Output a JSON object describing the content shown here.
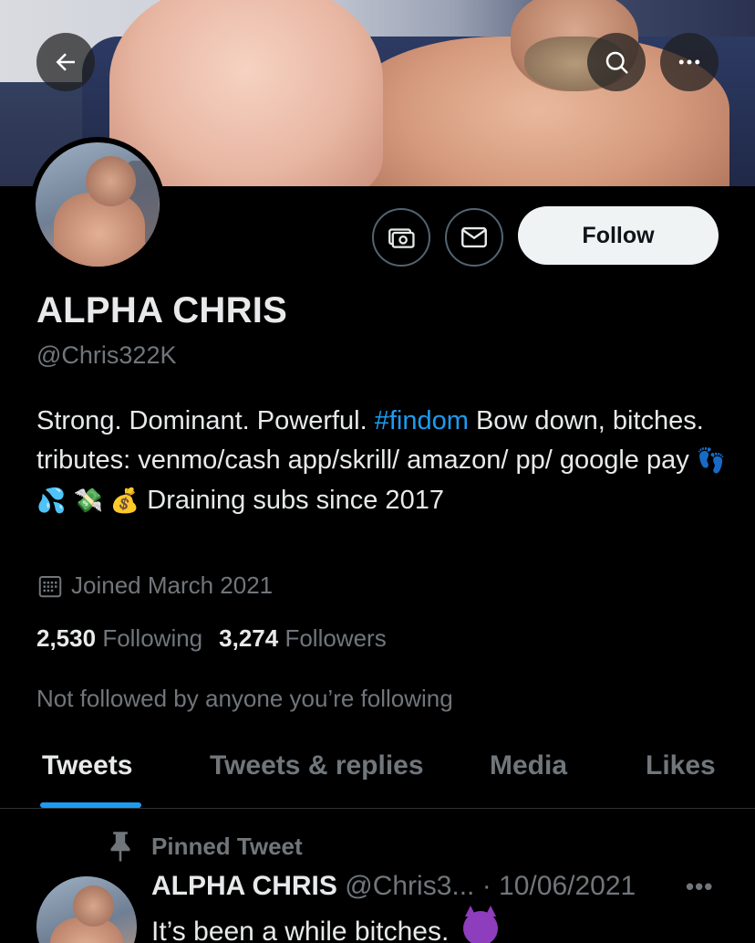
{
  "profile": {
    "name": "ALPHA CHRIS",
    "handle": "@Chris322K",
    "bio_part1": "Strong. Dominant. Powerful. ",
    "bio_hashtag": "#findom",
    "bio_part2": " Bow down, bitches. tributes: venmo/cash app/skrill/ amazon/ pp/ google pay ",
    "bio_emoji1": "👣",
    "bio_emoji2": "💦",
    "bio_emoji3": "💸",
    "bio_emoji4": "💰",
    "bio_part3": " Draining subs since 2017",
    "joined": "Joined March 2021",
    "following_count": "2,530",
    "following_label": "Following",
    "followers_count": "3,274",
    "followers_label": "Followers",
    "not_followed": "Not followed by anyone you’re following"
  },
  "actions": {
    "follow_label": "Follow"
  },
  "icons": {
    "back": "arrow-left-icon",
    "search": "search-icon",
    "more": "more-icon",
    "tip": "money-icon",
    "message": "envelope-icon",
    "calendar": "calendar-icon",
    "pin": "pin-icon"
  },
  "tabs": [
    {
      "label": "Tweets",
      "active": true
    },
    {
      "label": "Tweets & replies",
      "active": false
    },
    {
      "label": "Media",
      "active": false
    },
    {
      "label": "Likes",
      "active": false
    }
  ],
  "pinned_tweet": {
    "pinned_label": "Pinned Tweet",
    "author": "ALPHA CHRIS",
    "meta": " @Chris3... · 10/06/2021",
    "more": "•••",
    "text": "It’s been a while bitches."
  },
  "colors": {
    "accent": "#1d9bf0",
    "background": "#000000",
    "text_primary": "#e7e9ea",
    "text_secondary": "#71767b"
  }
}
